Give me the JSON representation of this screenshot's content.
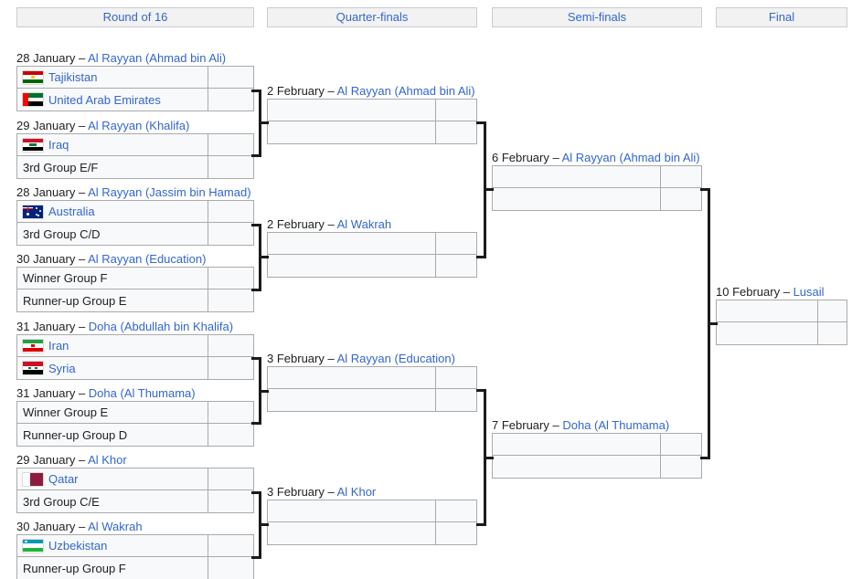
{
  "rounds": [
    {
      "label": "Round of 16"
    },
    {
      "label": "Quarter-finals"
    },
    {
      "label": "Semi-finals"
    },
    {
      "label": "Final"
    }
  ],
  "round_of_16": [
    {
      "date": "28 January",
      "dash": " – ",
      "venue": "Al Rayyan (Ahmad bin Ali)",
      "teams": [
        {
          "name": "Tajikistan",
          "flag": "tajikistan",
          "score": "",
          "placeholder": false
        },
        {
          "name": "United Arab Emirates",
          "flag": "united-arab-emirates",
          "score": "",
          "placeholder": false
        }
      ]
    },
    {
      "date": "29 January",
      "dash": " – ",
      "venue": "Al Rayyan (Khalifa)",
      "teams": [
        {
          "name": "Iraq",
          "flag": "iraq",
          "score": "",
          "placeholder": false
        },
        {
          "name": "3rd Group E/F",
          "flag": "",
          "score": "",
          "placeholder": true
        }
      ]
    },
    {
      "date": "28 January",
      "dash": " – ",
      "venue": "Al Rayyan (Jassim bin Hamad)",
      "teams": [
        {
          "name": "Australia",
          "flag": "australia",
          "score": "",
          "placeholder": false
        },
        {
          "name": "3rd Group C/D",
          "flag": "",
          "score": "",
          "placeholder": true
        }
      ]
    },
    {
      "date": "30 January",
      "dash": " – ",
      "venue": "Al Rayyan (Education)",
      "teams": [
        {
          "name": "Winner Group F",
          "flag": "",
          "score": "",
          "placeholder": true
        },
        {
          "name": "Runner-up Group E",
          "flag": "",
          "score": "",
          "placeholder": true
        }
      ]
    },
    {
      "date": "31 January",
      "dash": " – ",
      "venue": "Doha (Abdullah bin Khalifa)",
      "teams": [
        {
          "name": "Iran",
          "flag": "iran",
          "score": "",
          "placeholder": false
        },
        {
          "name": "Syria",
          "flag": "syria",
          "score": "",
          "placeholder": false
        }
      ]
    },
    {
      "date": "31 January",
      "dash": " – ",
      "venue": "Doha (Al Thumama)",
      "teams": [
        {
          "name": "Winner Group E",
          "flag": "",
          "score": "",
          "placeholder": true
        },
        {
          "name": "Runner-up Group D",
          "flag": "",
          "score": "",
          "placeholder": true
        }
      ]
    },
    {
      "date": "29 January",
      "dash": " – ",
      "venue": "Al Khor",
      "teams": [
        {
          "name": "Qatar",
          "flag": "qatar",
          "score": "",
          "placeholder": false
        },
        {
          "name": "3rd Group C/E",
          "flag": "",
          "score": "",
          "placeholder": true
        }
      ]
    },
    {
      "date": "30 January",
      "dash": " – ",
      "venue": "Al Wakrah",
      "teams": [
        {
          "name": "Uzbekistan",
          "flag": "uzbekistan",
          "score": "",
          "placeholder": false
        },
        {
          "name": "Runner-up Group F",
          "flag": "",
          "score": "",
          "placeholder": true
        }
      ]
    }
  ],
  "quarter_finals": [
    {
      "date": "2 February",
      "dash": " – ",
      "venue": "Al Rayyan (Ahmad bin Ali)",
      "teams": [
        {
          "name": "",
          "flag": "",
          "score": "",
          "placeholder": true
        },
        {
          "name": "",
          "flag": "",
          "score": "",
          "placeholder": true
        }
      ]
    },
    {
      "date": "2 February",
      "dash": " – ",
      "venue": "Al Wakrah",
      "teams": [
        {
          "name": "",
          "flag": "",
          "score": "",
          "placeholder": true
        },
        {
          "name": "",
          "flag": "",
          "score": "",
          "placeholder": true
        }
      ]
    },
    {
      "date": "3 February",
      "dash": " – ",
      "venue": "Al Rayyan (Education)",
      "teams": [
        {
          "name": "",
          "flag": "",
          "score": "",
          "placeholder": true
        },
        {
          "name": "",
          "flag": "",
          "score": "",
          "placeholder": true
        }
      ]
    },
    {
      "date": "3 February",
      "dash": " – ",
      "venue": "Al Khor",
      "teams": [
        {
          "name": "",
          "flag": "",
          "score": "",
          "placeholder": true
        },
        {
          "name": "",
          "flag": "",
          "score": "",
          "placeholder": true
        }
      ]
    }
  ],
  "semi_finals": [
    {
      "date": "6 February",
      "dash": " – ",
      "venue": "Al Rayyan (Ahmad bin Ali)",
      "teams": [
        {
          "name": "",
          "flag": "",
          "score": "",
          "placeholder": true
        },
        {
          "name": "",
          "flag": "",
          "score": "",
          "placeholder": true
        }
      ]
    },
    {
      "date": "7 February",
      "dash": " – ",
      "venue": "Doha (Al Thumama)",
      "teams": [
        {
          "name": "",
          "flag": "",
          "score": "",
          "placeholder": true
        },
        {
          "name": "",
          "flag": "",
          "score": "",
          "placeholder": true
        }
      ]
    }
  ],
  "final": [
    {
      "date": "10 February",
      "dash": " – ",
      "venue": "Lusail",
      "teams": [
        {
          "name": "",
          "flag": "",
          "score": "",
          "placeholder": true
        },
        {
          "name": "",
          "flag": "",
          "score": "",
          "placeholder": true
        }
      ]
    }
  ],
  "colors": {
    "link": "#3366cc",
    "text": "#202122",
    "header_bg": "#f2f2f2",
    "header_border": "#c8ccd1",
    "cell_bg": "#f8f9fa",
    "cell_border": "#aaaaaa",
    "connector": "#1b1b1b"
  }
}
